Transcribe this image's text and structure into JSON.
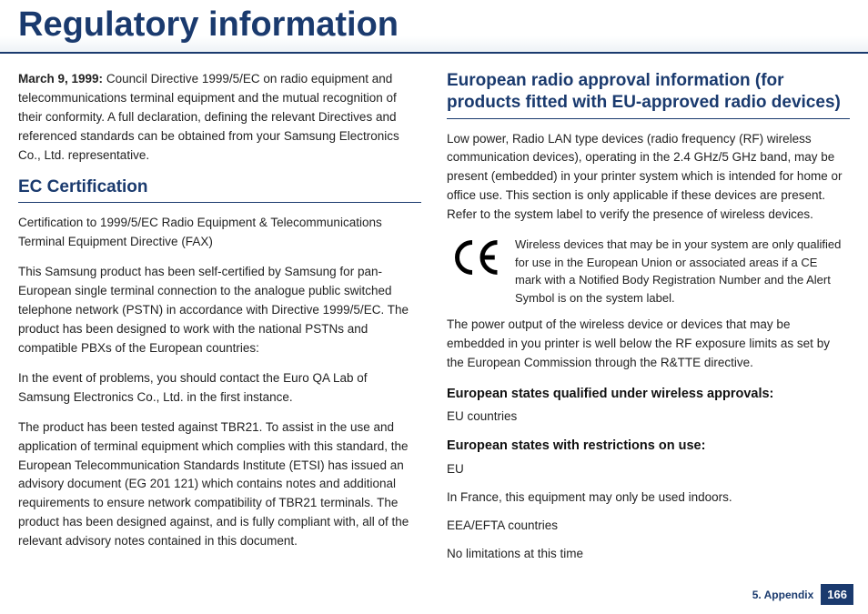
{
  "title": "Regulatory information",
  "left": {
    "intro_date": "March 9, 1999:",
    "intro_body": " Council Directive 1999/5/EC on radio equipment and telecommunications terminal equipment and the mutual recognition of their conformity. A full declaration, defining the relevant Directives and referenced standards can be obtained from your Samsung Electronics Co., Ltd. representative.",
    "ec_heading": "EC Certification",
    "ec_p1": "Certification to 1999/5/EC Radio Equipment & Telecommunications Terminal Equipment Directive (FAX)",
    "ec_p2": "This Samsung product has been self-certified by Samsung for pan-European single terminal connection to the analogue public switched telephone network (PSTN) in accordance with Directive 1999/5/EC. The product has been designed to work with the national PSTNs and compatible PBXs of the European countries:",
    "ec_p3": "In the event of problems, you should contact the Euro QA Lab of Samsung Electronics Co., Ltd. in the first instance.",
    "ec_p4": "The product has been tested against TBR21. To assist in the use and application of terminal equipment which complies with this standard, the European Telecommunication Standards Institute (ETSI) has issued an advisory document (EG 201 121) which contains notes and additional requirements to ensure network compatibility of TBR21 terminals. The product has been designed against, and is fully compliant with, all of the relevant advisory notes contained in this document."
  },
  "right": {
    "era_heading": "European radio approval information (for products fitted with EU-approved radio devices)",
    "era_p1": "Low power, Radio LAN type devices (radio frequency (RF) wireless communication devices), operating in the 2.4 GHz/5 GHz band, may be present (embedded) in your printer system which is intended for home or office use. This section is only applicable if these devices are present. Refer to the system label to verify the presence of wireless devices.",
    "ce_note": "Wireless devices that may be in your system are only qualified for use in the European Union or associated areas if a CE mark with a Notified Body Registration Number and the Alert Symbol is on the system label.",
    "era_p2": "The power output of the wireless device or devices that may be embedded in you printer is well below the RF exposure limits as set by the European Commission through the R&TTE directive.",
    "qual_heading": "European states qualified under wireless approvals:",
    "qual_body": "EU countries",
    "restr_heading": "European states with restrictions on use:",
    "restr_l1": "EU",
    "restr_l2": "In France, this equipment may only be used indoors.",
    "restr_l3": "EEA/EFTA countries",
    "restr_l4": "No limitations at this time"
  },
  "footer": {
    "chapter": "5. Appendix",
    "page": "166"
  }
}
